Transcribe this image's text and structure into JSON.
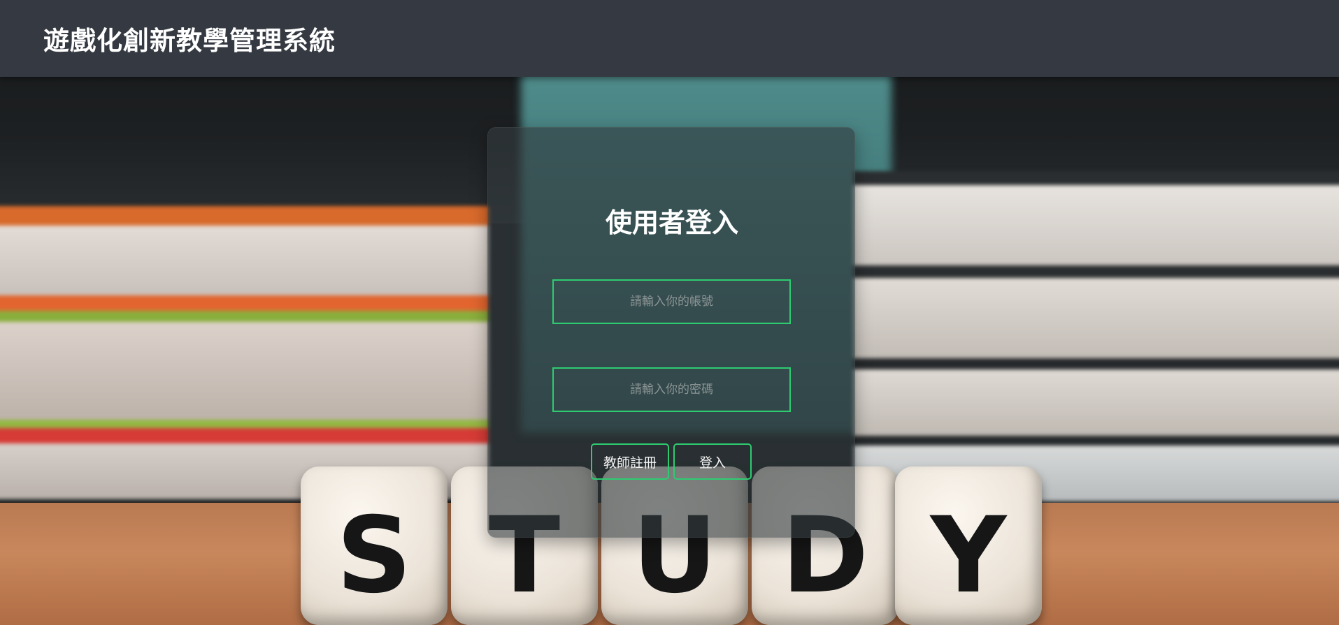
{
  "navbar": {
    "brand": "遊戲化創新教學管理系統"
  },
  "login": {
    "title": "使用者登入",
    "account_placeholder": "請輸入你的帳號",
    "password_placeholder": "請輸入你的密碼",
    "register_label": "教師註冊",
    "login_label": "登入"
  },
  "background": {
    "dice_letters": [
      "S",
      "T",
      "U",
      "D",
      "Y"
    ]
  },
  "colors": {
    "navbar": "#353a42",
    "accent": "#2ecc71",
    "card": "rgba(50,58,62,0.62)"
  }
}
